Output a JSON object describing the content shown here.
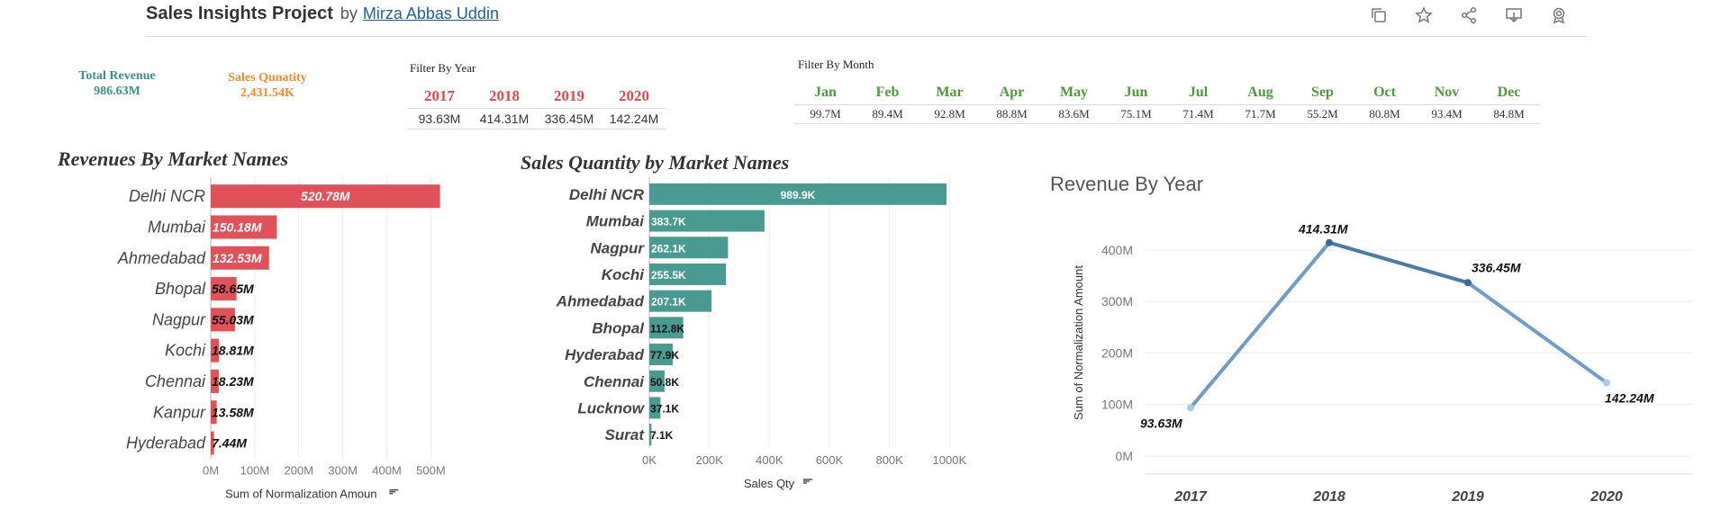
{
  "header": {
    "title": "Sales Insights Project",
    "by": "by",
    "author": "Mirza Abbas Uddin"
  },
  "toolbar": {
    "icons": [
      "copy-icon",
      "star-icon",
      "share-icon",
      "download-icon",
      "badge-icon"
    ]
  },
  "kpis": {
    "total_revenue_label": "Total Revenue",
    "total_revenue_value": "986.63M",
    "sales_quantity_label": "Sales Qunatity",
    "sales_quantity_value": "2,431.54K"
  },
  "year_filter": {
    "label": "Filter By Year",
    "years": [
      "2017",
      "2018",
      "2019",
      "2020"
    ],
    "values": [
      "93.63M",
      "414.31M",
      "336.45M",
      "142.24M"
    ]
  },
  "month_filter": {
    "label": "Filter By Month",
    "months": [
      "Jan",
      "Feb",
      "Mar",
      "Apr",
      "May",
      "Jun",
      "Jul",
      "Aug",
      "Sep",
      "Oct",
      "Nov",
      "Dec"
    ],
    "values": [
      "99.7M",
      "89.4M",
      "92.8M",
      "88.8M",
      "83.6M",
      "75.1M",
      "71.4M",
      "71.7M",
      "55.2M",
      "80.8M",
      "93.4M",
      "84.8M"
    ]
  },
  "colors": {
    "revenue_bar": "#e05257",
    "quantity_bar": "#4a9a94",
    "line_dark": "#3b6a96",
    "line_light": "#a8cce5"
  },
  "chart_data": [
    {
      "type": "bar",
      "title": "Revenues By Market Names",
      "orientation": "horizontal",
      "categories": [
        "Delhi NCR",
        "Mumbai",
        "Ahmedabad",
        "Bhopal",
        "Nagpur",
        "Kochi",
        "Chennai",
        "Kanpur",
        "Hyderabad"
      ],
      "values": [
        520.78,
        150.18,
        132.53,
        58.65,
        55.03,
        18.81,
        18.23,
        13.58,
        7.44
      ],
      "data_labels": [
        "520.78M",
        "150.18M",
        "132.53M",
        "58.65M",
        "55.03M",
        "18.81M",
        "18.23M",
        "13.58M",
        "7.44M"
      ],
      "xlabel": "Sum of Normalization Amoun",
      "xticks": [
        "0M",
        "100M",
        "200M",
        "300M",
        "400M",
        "500M"
      ],
      "xlim": [
        0,
        540
      ],
      "grid": true
    },
    {
      "type": "bar",
      "title": "Sales Quantity by Market Names",
      "orientation": "horizontal",
      "categories": [
        "Delhi NCR",
        "Mumbai",
        "Nagpur",
        "Kochi",
        "Ahmedabad",
        "Bhopal",
        "Hyderabad",
        "Chennai",
        "Lucknow",
        "Surat"
      ],
      "values": [
        989.9,
        383.7,
        262.1,
        255.5,
        207.1,
        112.8,
        77.9,
        50.8,
        37.1,
        7.1
      ],
      "data_labels": [
        "989.9K",
        "383.7K",
        "262.1K",
        "255.5K",
        "207.1K",
        "112.8K",
        "77.9K",
        "50.8K",
        "37.1K",
        "7.1K"
      ],
      "xlabel": "Sales Qty",
      "xticks": [
        "0K",
        "200K",
        "400K",
        "600K",
        "800K",
        "1000K"
      ],
      "xlim": [
        0,
        1050
      ],
      "grid": true
    },
    {
      "type": "line",
      "title": "Revenue By Year",
      "x": [
        "2017",
        "2018",
        "2019",
        "2020"
      ],
      "values": [
        93.63,
        414.31,
        336.45,
        142.24
      ],
      "data_labels": [
        "93.63M",
        "414.31M",
        "336.45M",
        "142.24M"
      ],
      "ylabel": "Sum of Normalization Amount",
      "yticks": [
        "0M",
        "100M",
        "200M",
        "300M",
        "400M"
      ],
      "ylim": [
        0,
        440
      ],
      "grid": true
    }
  ]
}
